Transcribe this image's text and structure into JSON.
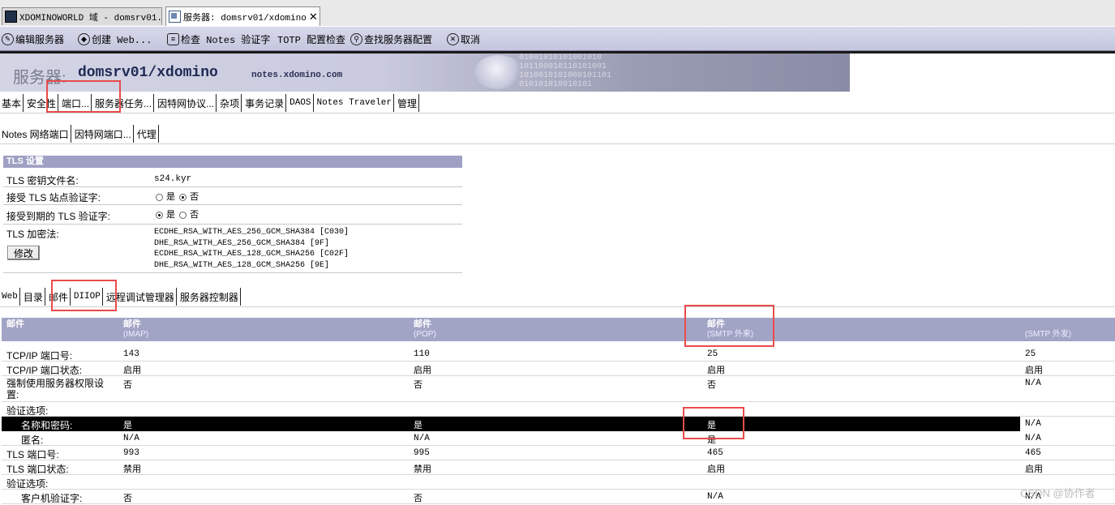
{
  "window_tabs": [
    {
      "label": "XDOMINOWORLD 域 - domsrv01..."
    },
    {
      "label": "服务器: domsrv01/xdomino",
      "close": "✕"
    }
  ],
  "action_bar": [
    {
      "label": "编辑服务器",
      "icon": "edit-icon"
    },
    {
      "label": "创建 Web...",
      "icon": "create-web-icon"
    },
    {
      "label": "检查 Notes 验证字",
      "icon": "check-icon"
    },
    {
      "label": "TOTP 配置检查",
      "icon": ""
    },
    {
      "label": "查找服务器配置",
      "icon": "search-icon"
    },
    {
      "label": "取消",
      "icon": "cancel-icon"
    }
  ],
  "banner": {
    "title_label": "服务器:",
    "server_name": "domsrv01/xdomino",
    "host": "notes.xdomino.com",
    "deco": "01001010101001010\n101100010110101001\n1010010101000101101\n010101010010101"
  },
  "main_tabs": [
    "基本",
    "安全性",
    "端口...",
    "服务器任务...",
    "因特网协议...",
    "杂项",
    "事务记录",
    "DAOS",
    "Notes Traveler",
    "管理"
  ],
  "port_tabs": [
    "Notes 网络端口",
    "因特网端口...",
    "代理"
  ],
  "tls": {
    "header": "TLS 设置",
    "keyfile_label": "TLS 密钥文件名:",
    "keyfile_value": "s24.kyr",
    "accept_site_label": "接受 TLS 站点验证字:",
    "accept_expired_label": "接受到期的 TLS 验证字:",
    "yes": "是",
    "no": "否",
    "accept_site_selected": "否",
    "accept_expired_selected": "是",
    "cipher_label": "TLS 加密法:",
    "ciphers": [
      "ECDHE_RSA_WITH_AES_256_GCM_SHA384 [C030]",
      "DHE_RSA_WITH_AES_256_GCM_SHA384 [9F]",
      "ECDHE_RSA_WITH_AES_128_GCM_SHA256 [C02F]",
      "DHE_RSA_WITH_AES_128_GCM_SHA256 [9E]"
    ],
    "modify_button": "修改"
  },
  "protocol_tabs": [
    "Web",
    "目录",
    "邮件",
    "DIIOP",
    "远程调试管理器",
    "服务器控制器"
  ],
  "mail_table": {
    "headers": [
      {
        "title": "邮件",
        "sub": ""
      },
      {
        "title": "邮件",
        "sub": "(IMAP)"
      },
      {
        "title": "邮件",
        "sub": "(POP)"
      },
      {
        "title": "邮件",
        "sub": "(SMTP 外来)"
      },
      {
        "title": "",
        "sub": "(SMTP 外发)"
      }
    ],
    "rows": [
      {
        "label": "TCP/IP 端口号:",
        "values": [
          "143",
          "110",
          "25",
          "25"
        ]
      },
      {
        "label": "TCP/IP 端口状态:",
        "values": [
          "启用",
          "启用",
          "启用",
          "启用"
        ]
      },
      {
        "label": "强制使用服务器权限设置:",
        "values": [
          "否",
          "否",
          "否",
          "N/A"
        ]
      },
      {
        "label": "验证选项:",
        "values": [
          "",
          "",
          "",
          ""
        ]
      },
      {
        "label": "名称和密码:",
        "values": [
          "是",
          "是",
          "是",
          "N/A"
        ],
        "selected": true
      },
      {
        "label": "匿名:",
        "values": [
          "N/A",
          "N/A",
          "是",
          "N/A"
        ]
      },
      {
        "label": "TLS 端口号:",
        "values": [
          "993",
          "995",
          "465",
          "465"
        ]
      },
      {
        "label": "TLS 端口状态:",
        "values": [
          "禁用",
          "禁用",
          "启用",
          "启用"
        ]
      },
      {
        "label": "验证选项:",
        "values": [
          "",
          "",
          "",
          ""
        ]
      },
      {
        "label": "客户机验证字:",
        "values": [
          "否",
          "否",
          "N/A",
          "N/A"
        ]
      }
    ]
  },
  "watermark": "CSDN @协作者",
  "colors": {
    "accent": "#a2a4c6",
    "highlight": "#e94b4b",
    "banner_text": "#1e2a55"
  }
}
